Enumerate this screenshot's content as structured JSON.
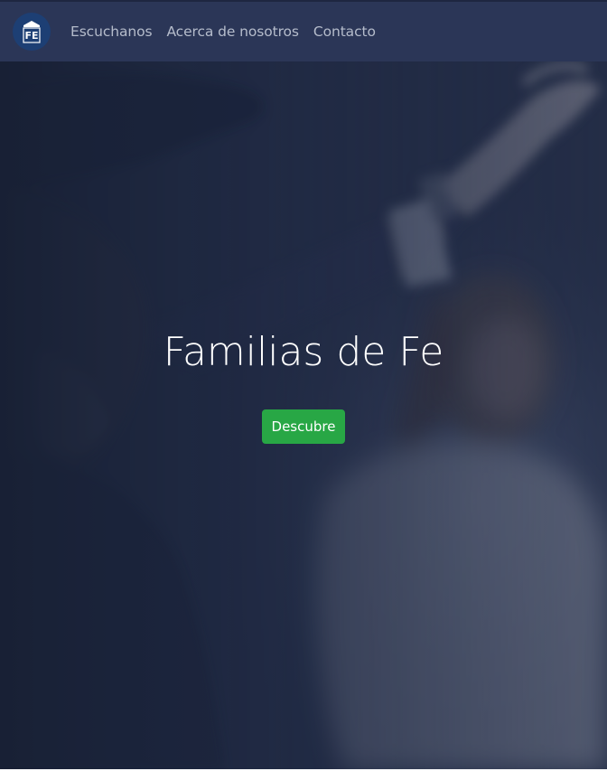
{
  "navbar": {
    "logo_text": "FE",
    "links": [
      {
        "label": "Escuchanos"
      },
      {
        "label": "Acerca de nosotros"
      },
      {
        "label": "Contacto"
      }
    ]
  },
  "hero": {
    "title": "Familias de Fe",
    "button_label": "Descubre"
  },
  "colors": {
    "navbar_bg": "#2b3657",
    "hero_overlay": "#1f2a45",
    "button_bg": "#28a745",
    "logo_bg": "#1d3f74"
  },
  "icons": {
    "logo": "church-logo-icon"
  }
}
